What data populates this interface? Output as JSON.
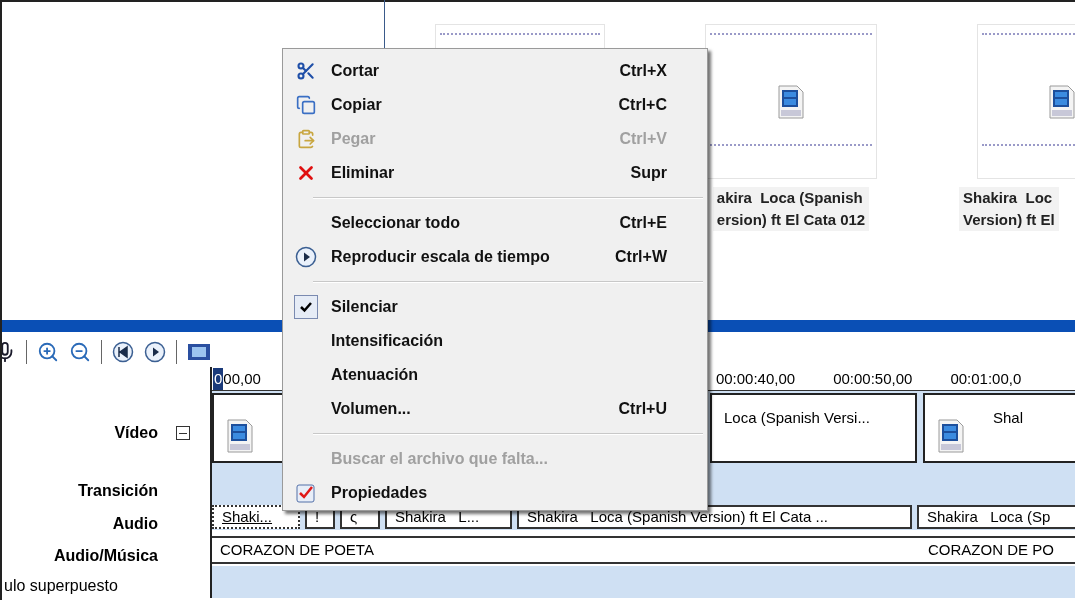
{
  "collection": {
    "clips": [
      {
        "kind": "video"
      },
      {
        "kind": "video",
        "caption_lines": [
          "akira  Loca (Spanish",
          "ersion) ft El Cata 012"
        ]
      },
      {
        "kind": "video",
        "caption_lines": [
          "Shakira  Loc",
          "Version) ft El"
        ]
      }
    ]
  },
  "timeline": {
    "ruler": [
      "0",
      "00,00",
      "00:00:40,00",
      "00:00:50,00",
      "00:01:00,0"
    ],
    "tracks": [
      {
        "label": "Vídeo",
        "kind": "video",
        "expanded": true,
        "clips": [
          {
            "kind": "video"
          },
          {
            "kind": "video",
            "title": "Loca (Spanish Versi..."
          },
          {
            "kind": "video",
            "title": "Shal"
          }
        ]
      },
      {
        "label": "Transición",
        "kind": "transition"
      },
      {
        "label": "Audio",
        "kind": "audio",
        "clips": [
          {
            "title": "Shaki..."
          },
          {
            "title": "!"
          },
          {
            "title": "ς"
          },
          {
            "title": "Shakira   L..."
          },
          {
            "title": "Shakira   Loca (Spanish Version) ft El Cata ..."
          },
          {
            "title": "Shakira   Loca (Sp"
          }
        ]
      },
      {
        "label": "Audio/Música",
        "kind": "music",
        "clips": [
          {
            "title": "CORAZON DE POETA"
          },
          {
            "title": "CORAZON DE PO"
          }
        ]
      },
      {
        "label": "ulo superpuesto",
        "kind": "overlay"
      }
    ]
  },
  "context_menu": {
    "items": [
      {
        "kind": "item",
        "label": "Cortar",
        "shortcut": "Ctrl+X",
        "disabled": false,
        "checked": false
      },
      {
        "kind": "item",
        "label": "Copiar",
        "shortcut": "Ctrl+C",
        "disabled": false,
        "checked": false
      },
      {
        "kind": "item",
        "label": "Pegar",
        "shortcut": "Ctrl+V",
        "disabled": true,
        "checked": false
      },
      {
        "kind": "item",
        "label": "Eliminar",
        "shortcut": "Supr",
        "disabled": false,
        "checked": false
      },
      {
        "kind": "separator"
      },
      {
        "kind": "item",
        "label": "Seleccionar todo",
        "shortcut": "Ctrl+E",
        "disabled": false,
        "checked": false
      },
      {
        "kind": "item",
        "label": "Reproducir escala de tiempo",
        "shortcut": "Ctrl+W",
        "disabled": false,
        "checked": false
      },
      {
        "kind": "separator"
      },
      {
        "kind": "item",
        "label": "Silenciar",
        "disabled": false,
        "checked": true
      },
      {
        "kind": "item",
        "label": "Intensificación",
        "disabled": false,
        "checked": false
      },
      {
        "kind": "item",
        "label": "Atenuación",
        "disabled": false,
        "checked": false
      },
      {
        "kind": "item",
        "label": "Volumen...",
        "shortcut": "Ctrl+U",
        "disabled": false,
        "checked": false
      },
      {
        "kind": "separator"
      },
      {
        "kind": "item",
        "label": "Buscar el archivo que falta...",
        "disabled": true,
        "checked": false
      },
      {
        "kind": "item",
        "label": "Propiedades",
        "disabled": false,
        "checked": false
      }
    ]
  }
}
